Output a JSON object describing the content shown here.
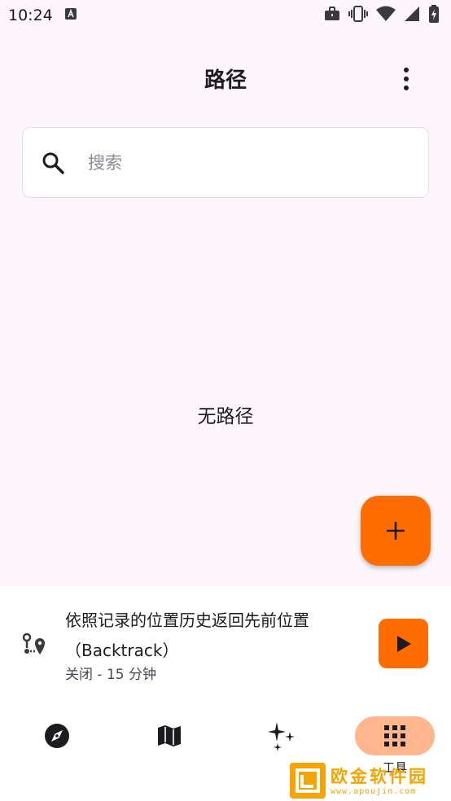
{
  "status_bar": {
    "time": "10:24",
    "icons": [
      "keyboard-a-icon",
      "briefcase-icon",
      "vibrate-icon",
      "wifi-icon",
      "signal-icon",
      "battery-charging-icon"
    ]
  },
  "app_bar": {
    "title": "路径",
    "menu_icon": "more-vert-icon"
  },
  "search": {
    "placeholder": "搜索",
    "value": ""
  },
  "empty_state": {
    "text": "无路径"
  },
  "fab": {
    "icon": "plus-icon"
  },
  "backtrack": {
    "title": "依照记录的位置历史返回先前位置（Backtrack）",
    "status": "关闭 - 15 分钟",
    "icon": "route-icon",
    "action_icon": "play-icon"
  },
  "bottom_nav": {
    "items": [
      {
        "name": "nav-navigate",
        "icon": "compass-icon",
        "label": ""
      },
      {
        "name": "nav-map",
        "icon": "map-icon",
        "label": ""
      },
      {
        "name": "nav-experimental",
        "icon": "sparkle-icon",
        "label": ""
      },
      {
        "name": "nav-tools",
        "icon": "grid-icon",
        "label": "工具",
        "active": true
      }
    ]
  },
  "watermark": {
    "title": "欧金软件园",
    "url": "www.apoujin.com"
  },
  "colors": {
    "accent": "#ff6d00",
    "background": "#fdf6fd",
    "nav_active": "#ffb68f",
    "watermark": "#f5a400"
  }
}
